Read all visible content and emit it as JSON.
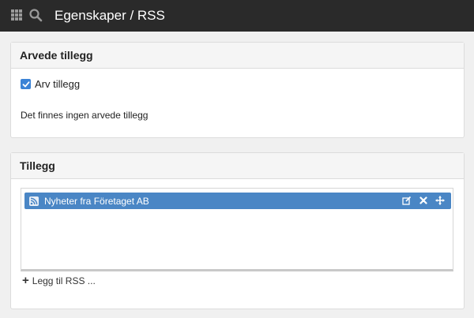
{
  "topbar": {
    "title": "Egenskaper / RSS",
    "apps_icon": "apps-grid-icon",
    "search_icon": "search-icon"
  },
  "inherited": {
    "heading": "Arvede tillegg",
    "checkbox_label": "Arv tillegg",
    "checkbox_checked": true,
    "empty_text": "Det finnes ingen arvede tillegg"
  },
  "addons": {
    "heading": "Tillegg",
    "items": [
      {
        "label": "Nyheter fra Företaget AB",
        "icon": "rss-icon"
      }
    ],
    "add_label": "Legg til RSS ..."
  },
  "colors": {
    "topbar": "#2a2a2a",
    "accent": "#4a86c5",
    "checkbox": "#3b83d6"
  }
}
